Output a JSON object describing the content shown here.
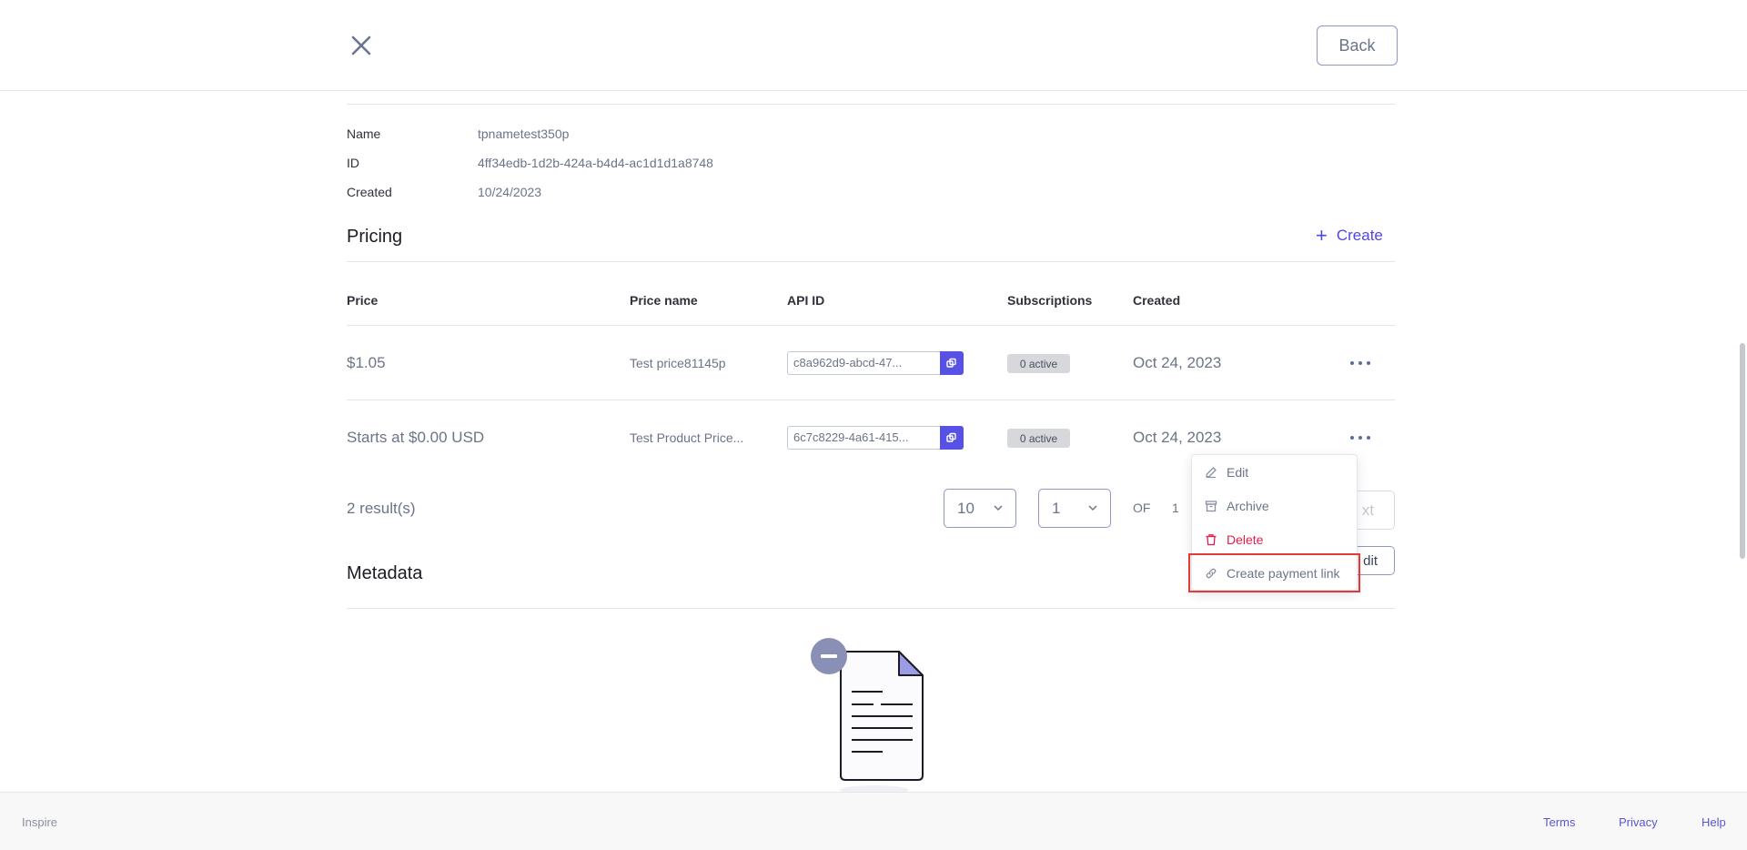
{
  "header": {
    "close_icon": "close-icon",
    "back_label": "Back"
  },
  "details": {
    "name_label": "Name",
    "name_value": "tpnametest350p",
    "id_label": "ID",
    "id_value": "4ff34edb-1d2b-424a-b4d4-ac1d1d1a8748",
    "created_label": "Created",
    "created_value": "10/24/2023"
  },
  "pricing": {
    "title": "Pricing",
    "create_label": "Create",
    "columns": [
      "Price",
      "Price name",
      "API ID",
      "Subscriptions",
      "Created"
    ],
    "rows": [
      {
        "price": "$1.05",
        "price_name": "Test price81145p",
        "api_id": "c8a962d9-abcd-47...",
        "subscriptions": "0 active",
        "created": "Oct 24, 2023"
      },
      {
        "price": "Starts at $0.00 USD",
        "price_name": "Test Product Price...",
        "api_id": "6c7c8229-4a61-415...",
        "subscriptions": "0 active",
        "created": "Oct 24, 2023"
      }
    ],
    "results_text": "2 result(s)",
    "page_size": "10",
    "page_number": "1",
    "of_label": "OF",
    "total_pages": "1",
    "next_label": "xt"
  },
  "row_menu": {
    "items": [
      {
        "label": "Edit",
        "icon": "pencil-icon"
      },
      {
        "label": "Archive",
        "icon": "archive-icon"
      },
      {
        "label": "Delete",
        "icon": "trash-icon"
      },
      {
        "label": "Create payment link",
        "icon": "link-icon"
      }
    ],
    "highlighted_item": "Create payment link",
    "highlight_color": "#e53935"
  },
  "metadata": {
    "title": "Metadata",
    "edit_label": "dit",
    "empty_icon": "empty-document-icon"
  },
  "footer": {
    "brand": "Inspire",
    "links": [
      "Terms",
      "Privacy",
      "Help"
    ]
  },
  "colors": {
    "accent": "#4f46e5",
    "copy_button": "#5751e6",
    "danger": "#e11d48",
    "badge_bg": "#d7d8dc"
  }
}
